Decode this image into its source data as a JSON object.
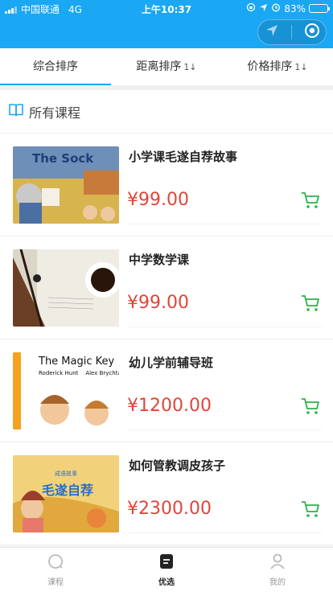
{
  "status_bar": {
    "carrier": "中国联通",
    "network": "4G",
    "time": "上午10:37",
    "battery": "83%",
    "battery_level": 0.83
  },
  "capsule": {
    "icons": [
      "location-arrow-icon",
      "target-icon"
    ]
  },
  "sort_tabs": [
    {
      "label": "综合排序",
      "arrow": ""
    },
    {
      "label": "距离排序",
      "arrow": "1↓"
    },
    {
      "label": "价格排序",
      "arrow": "1↓"
    }
  ],
  "section": {
    "title": "所有课程",
    "icon": "book-open-icon"
  },
  "courses": [
    {
      "name": "小学课毛遂自荐故事",
      "price": "¥99.00"
    },
    {
      "name": "中学数学课",
      "price": "¥99.00"
    },
    {
      "name": "幼儿学前辅导班",
      "price": "¥1200.00"
    },
    {
      "name": "如何管教调皮孩子",
      "price": "¥2300.00"
    }
  ],
  "thumb_text": {
    "sock": "The Sock",
    "magic_title": "The Magic Key",
    "magic_authors": "Roderick Hunt    Alex Brychta",
    "story_small": "成语故事",
    "story_big": "毛遂自荐"
  },
  "tabbar": [
    {
      "label": "课程",
      "icon": "search-icon"
    },
    {
      "label": "优选",
      "icon": "note-icon"
    },
    {
      "label": "我的",
      "icon": "user-icon"
    }
  ],
  "colors": {
    "primary": "#1aa7f3",
    "price": "#e0463a",
    "cart": "#2fb14a"
  }
}
